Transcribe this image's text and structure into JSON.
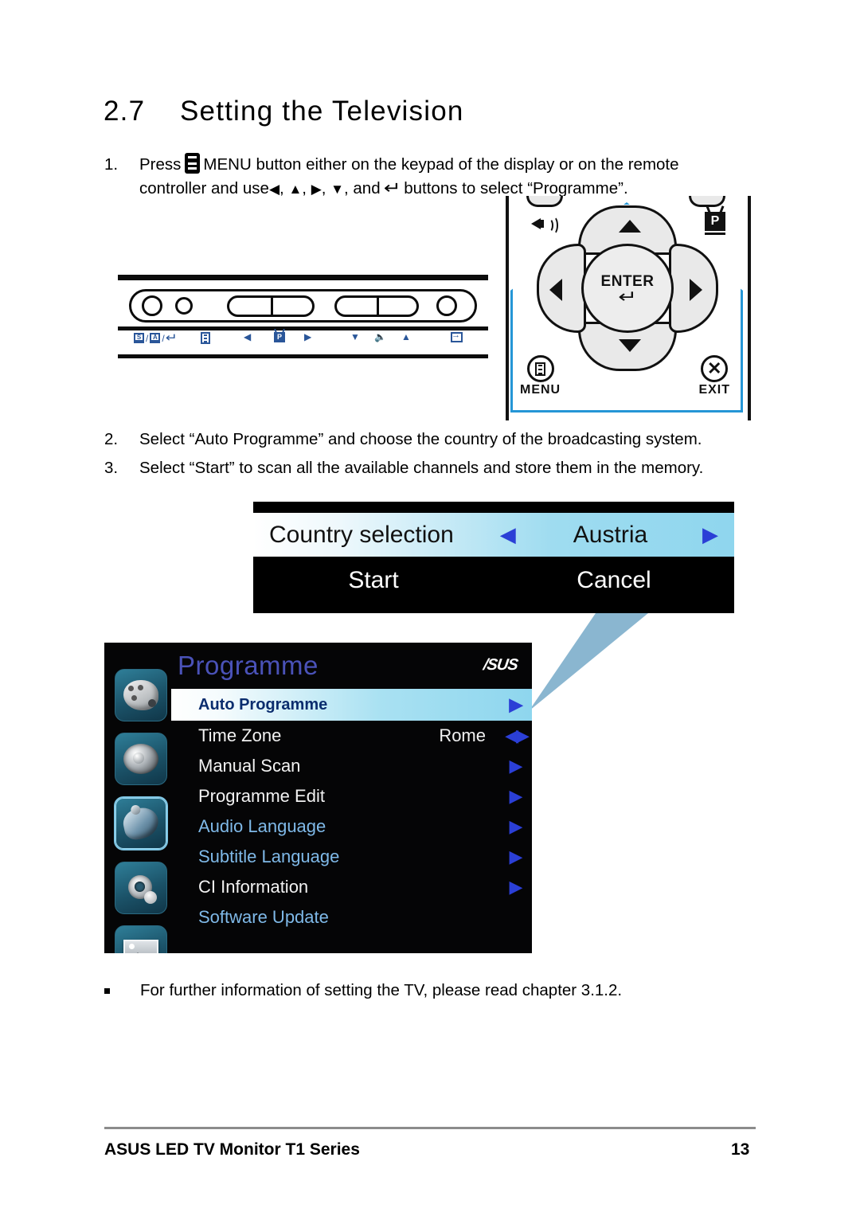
{
  "heading": {
    "number": "2.7",
    "title": "Setting the Television"
  },
  "steps": [
    {
      "index": "1.",
      "text_before_icon": "Press",
      "icon": "menu-icon",
      "text_line1_after_icon": "MENU button either on the keypad of the display or on the remote",
      "text_line2_a": "controller and use",
      "glyph_left": "◀",
      "glyph_up": "▲",
      "glyph_right": "▶",
      "glyph_down": "▼",
      "text_line2_b": ", and",
      "glyph_enter": "↵",
      "text_line2_c": "buttons to select “Programme”."
    },
    {
      "index": "2.",
      "text": "Select “Auto Programme” and choose the country of the broadcasting system."
    },
    {
      "index": "3.",
      "text": "Select “Start” to scan all the available channels and store them in the memory."
    }
  ],
  "keypad": {
    "icons": [
      {
        "name": "source-auto-enter-icon",
        "label": "S / A / ↵"
      },
      {
        "name": "menu-icon",
        "label": "menu"
      },
      {
        "name": "left-arrow-icon",
        "label": "◀"
      },
      {
        "name": "programme-icon",
        "label": "P"
      },
      {
        "name": "right-arrow-icon",
        "label": "▶"
      },
      {
        "name": "volume-down-icon",
        "label": "▼"
      },
      {
        "name": "speaker-icon",
        "label": "speaker"
      },
      {
        "name": "volume-up-icon",
        "label": "▲"
      },
      {
        "name": "input-select-icon",
        "label": "input"
      }
    ]
  },
  "remote": {
    "enter_label": "ENTER",
    "enter_glyph": "↵",
    "menu_label": "MENU",
    "exit_label": "EXIT",
    "exit_glyph": "✕",
    "programme_label": "P",
    "up_glyph": "▲",
    "down_glyph": "▼",
    "left_glyph": "◀",
    "right_glyph": "▶",
    "accent_color": "#2596d6"
  },
  "country_dialog": {
    "label": "Country selection",
    "value": "Austria",
    "left_arrow": "◀",
    "right_arrow": "▶",
    "start_label": "Start",
    "cancel_label": "Cancel",
    "highlight_color": "#8fd6ee"
  },
  "osd": {
    "title": "Programme",
    "brand": "/SUS",
    "icons": [
      {
        "name": "picture-palette-icon",
        "selected": false
      },
      {
        "name": "sound-speaker-icon",
        "selected": false
      },
      {
        "name": "programme-dish-icon",
        "selected": true
      },
      {
        "name": "settings-gears-icon",
        "selected": false
      },
      {
        "name": "image-frame-icon",
        "selected": false
      }
    ],
    "rows": [
      {
        "label": "Auto Programme",
        "value": "",
        "caret": "▶",
        "highlighted": true,
        "dimmed": false,
        "lr": false
      },
      {
        "label": "Time Zone",
        "value": "Rome",
        "caret": "",
        "highlighted": false,
        "dimmed": false,
        "lr": true
      },
      {
        "label": "Manual Scan",
        "value": "",
        "caret": "▶",
        "highlighted": false,
        "dimmed": false,
        "lr": false
      },
      {
        "label": "Programme Edit",
        "value": "",
        "caret": "▶",
        "highlighted": false,
        "dimmed": false,
        "lr": false
      },
      {
        "label": "Audio Language",
        "value": "",
        "caret": "▶",
        "highlighted": false,
        "dimmed": true,
        "lr": false
      },
      {
        "label": "Subtitle Language",
        "value": "",
        "caret": "▶",
        "highlighted": false,
        "dimmed": true,
        "lr": false
      },
      {
        "label": "CI Information",
        "value": "",
        "caret": "▶",
        "highlighted": false,
        "dimmed": false,
        "lr": false
      },
      {
        "label": "Software Update",
        "value": "",
        "caret": "",
        "highlighted": false,
        "dimmed": true,
        "lr": false
      }
    ],
    "title_color": "#4a52b8",
    "dim_color": "#7fb9e8"
  },
  "note": {
    "bullet": "▪",
    "text": "For further information of setting the TV, please read chapter 3.1.2."
  },
  "footer": {
    "left": "ASUS LED TV Monitor T1 Series",
    "page": "13"
  }
}
